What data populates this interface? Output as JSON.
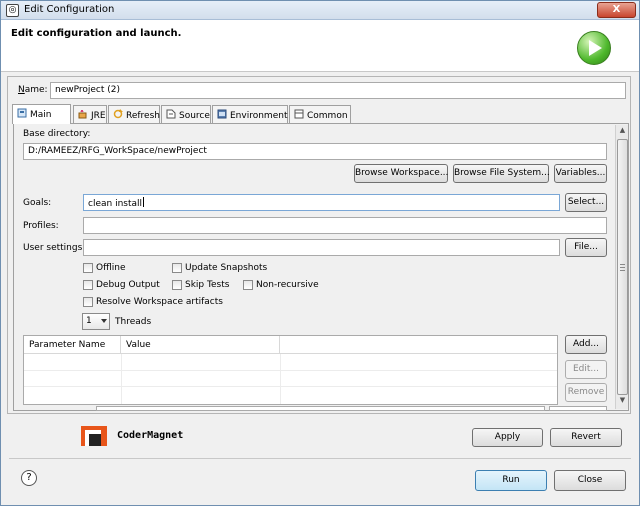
{
  "window": {
    "title": "Edit Configuration",
    "close_label": "X"
  },
  "banner": {
    "title": "Edit configuration and launch."
  },
  "name_field": {
    "label_ul": "N",
    "label_rest": "ame:",
    "value": "newProject (2)"
  },
  "tabs": [
    {
      "label": "Main",
      "icon": "main-tab-icon"
    },
    {
      "label": "JRE",
      "icon": "jre-icon"
    },
    {
      "label": "Refresh",
      "icon": "refresh-icon"
    },
    {
      "label": "Source",
      "icon": "source-icon"
    },
    {
      "label": "Environment",
      "icon": "environment-icon"
    },
    {
      "label": "Common",
      "icon": "common-icon"
    }
  ],
  "main": {
    "base_dir_label": "Base directory:",
    "base_dir_value": "D:/RAMEEZ/RFG_WorkSpace/newProject",
    "browse_workspace": "Browse Workspace...",
    "browse_fs": "Browse File System...",
    "variables": "Variables...",
    "goals_label": "Goals:",
    "goals_value": "clean install",
    "select_button": "Select...",
    "profiles_label": "Profiles:",
    "profiles_value": "",
    "user_settings_label": "User settings:",
    "user_settings_value": "",
    "file_button": "File...",
    "checkboxes": {
      "offline": "Offline",
      "update_snapshots": "Update Snapshots",
      "debug_output": "Debug Output",
      "skip_tests": "Skip Tests",
      "non_recursive": "Non-recursive",
      "resolve_workspace": "Resolve Workspace artifacts"
    },
    "threads_value": "1",
    "threads_label": "Threads",
    "params_table": {
      "columns": [
        "Parameter Name",
        "Value"
      ]
    },
    "add_button": "Add...",
    "edit_button": "Edit...",
    "remove_button": "Remove"
  },
  "footer": {
    "brand": "CoderMagnet",
    "apply": "Apply",
    "revert": "Revert",
    "run": "Run",
    "close": "Close",
    "help": "?"
  },
  "colors": {
    "accent": "#3c7fb1",
    "run_green": "#4eb82c",
    "brand_orange": "#e8551a"
  }
}
